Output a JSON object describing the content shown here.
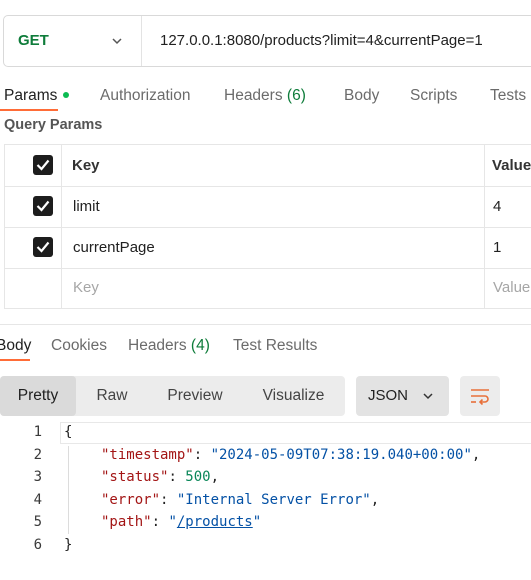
{
  "request": {
    "method": "GET",
    "url": "127.0.0.1:8080/products?limit=4&currentPage=1"
  },
  "request_tabs": {
    "params": "Params",
    "authorization": "Authorization",
    "headers": "Headers",
    "headers_count": "(6)",
    "body": "Body",
    "scripts": "Scripts",
    "tests": "Tests"
  },
  "query_params": {
    "title": "Query Params",
    "header_key": "Key",
    "header_value": "Value",
    "rows": [
      {
        "key": "limit",
        "value": "4",
        "checked": true
      },
      {
        "key": "currentPage",
        "value": "1",
        "checked": true
      }
    ],
    "placeholder_key": "Key",
    "placeholder_value": "Value"
  },
  "response_tabs": {
    "body": "Body",
    "cookies": "Cookies",
    "headers": "Headers",
    "headers_count": "(4)",
    "test_results": "Test Results"
  },
  "view_modes": {
    "pretty": "Pretty",
    "raw": "Raw",
    "preview": "Preview",
    "visualize": "Visualize",
    "format": "JSON"
  },
  "response_body": {
    "line_numbers": [
      "1",
      "2",
      "3",
      "4",
      "5",
      "6"
    ],
    "open_brace": "{",
    "close_brace": "}",
    "timestamp_key": "\"timestamp\"",
    "timestamp_value": "\"2024-05-09T07:38:19.040+00:00\"",
    "status_key": "\"status\"",
    "status_value": "500",
    "error_key": "\"error\"",
    "error_value": "\"Internal Server Error\"",
    "path_key": "\"path\"",
    "path_value": "/products",
    "quote": "\""
  },
  "colors": {
    "accent": "#ff6c37",
    "method_get": "#0e7c3a",
    "status_dot": "#0cbb52"
  }
}
